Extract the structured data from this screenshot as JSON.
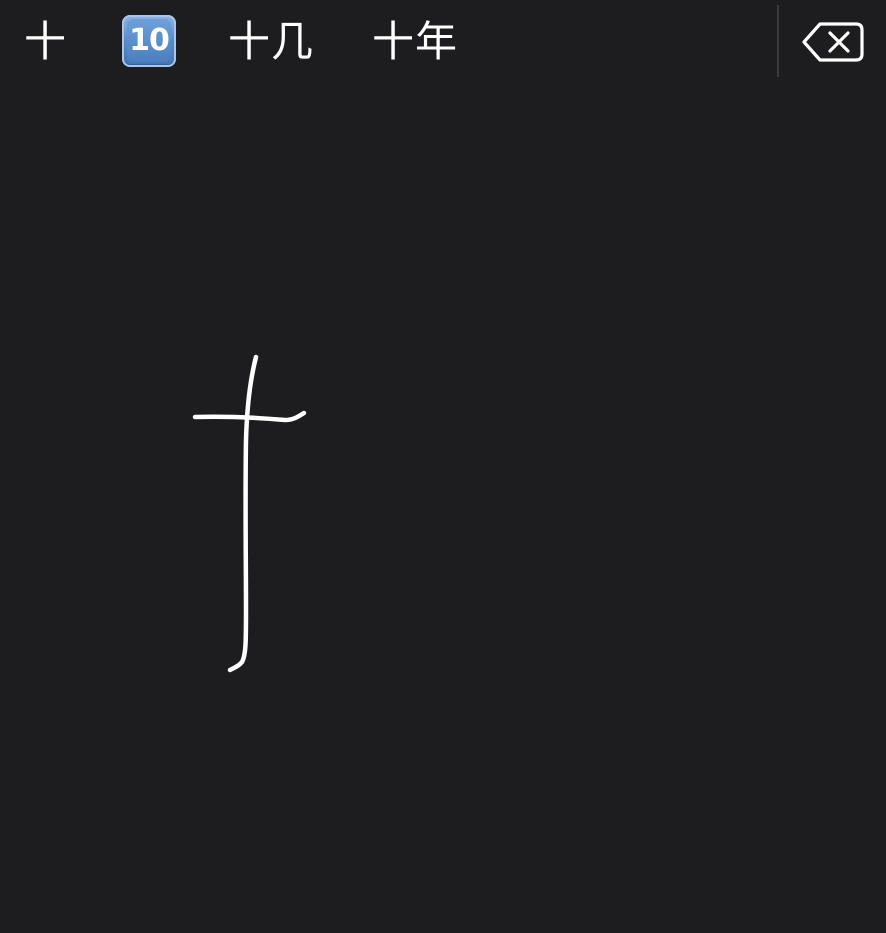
{
  "candidates": {
    "items": [
      {
        "label": "十"
      },
      {
        "label": "10",
        "icon": "keycap-ten-emoji-icon",
        "color": "#5a8ec9"
      },
      {
        "label": "十几"
      },
      {
        "label": "十年"
      }
    ]
  },
  "delete_key": {
    "icon": "backspace-icon"
  },
  "handwriting": {
    "ink_color": "#ffffff",
    "background_color": "#1d1c1f"
  }
}
